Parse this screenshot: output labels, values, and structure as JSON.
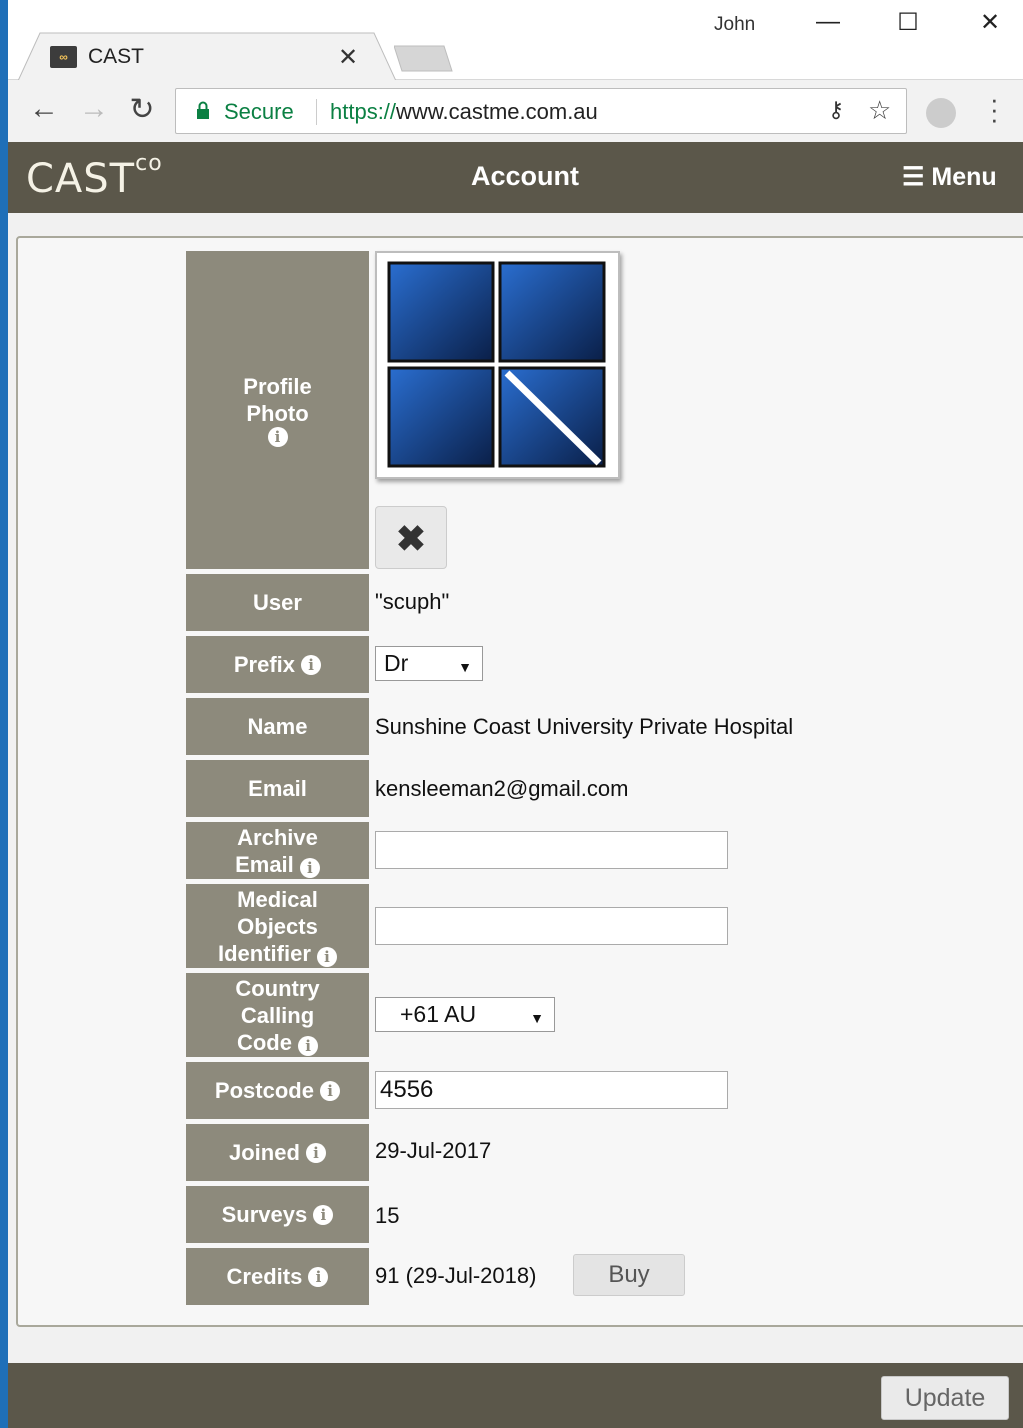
{
  "browser": {
    "window_user": "John",
    "tab_title": "CAST",
    "secure_label": "Secure",
    "url_scheme": "https://",
    "url_host": "www.castme.com.au"
  },
  "header": {
    "logo": "CAST",
    "logo_suffix": "co",
    "title": "Account",
    "menu_label": "Menu"
  },
  "profile": {
    "photo_label_line1": "Profile",
    "photo_label_line2": "Photo"
  },
  "fields": {
    "user_label": "User",
    "user_value": "\"scuph\"",
    "prefix_label": "Prefix",
    "prefix_value": "Dr",
    "name_label": "Name",
    "name_value": "Sunshine Coast University Private Hospital",
    "email_label": "Email",
    "email_value": "kensleeman2@gmail.com",
    "archive_label_line1": "Archive",
    "archive_label_line2": "Email",
    "archive_value": "",
    "moi_label_line1": "Medical",
    "moi_label_line2": "Objects",
    "moi_label_line3": "Identifier",
    "moi_value": "",
    "ccc_label_line1": "Country",
    "ccc_label_line2": "Calling",
    "ccc_label_line3": "Code",
    "ccc_value": "+61 AU",
    "postcode_label": "Postcode",
    "postcode_value": "4556",
    "joined_label": "Joined",
    "joined_value": "29-Jul-2017",
    "surveys_label": "Surveys",
    "surveys_value": "15",
    "credits_label": "Credits",
    "credits_value": "91 (29-Jul-2018)",
    "buy_label": "Buy"
  },
  "footer": {
    "update_label": "Update"
  },
  "icons": {
    "info": "info-icon",
    "remove": "close-icon",
    "menu": "hamburger-icon"
  }
}
